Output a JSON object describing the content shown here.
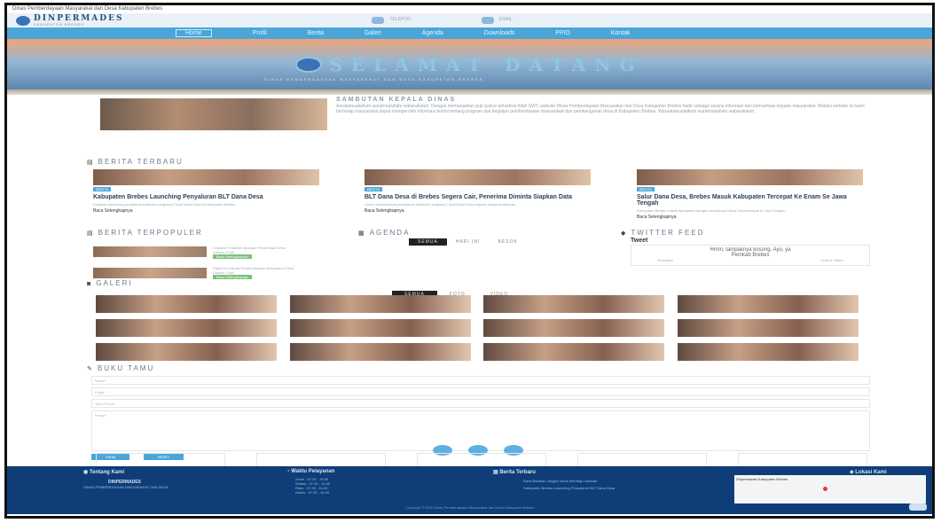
{
  "browser": {
    "title": "Dinas Pemberdayaan Masyarakat dan Desa Kabupaten Brebes"
  },
  "brand": {
    "name": "DINPERMADES",
    "tagline": "KABUPATEN BREBES"
  },
  "header": {
    "phone_label": "TELEPON",
    "email_label": "EMAIL"
  },
  "nav": {
    "items": [
      "Home",
      "Profil",
      "Berita",
      "Galeri",
      "Agenda",
      "Downloads",
      "PPID",
      "Kontak"
    ],
    "active": "Home"
  },
  "hero": {
    "title": "SELAMAT DATANG",
    "subtitle": "DINAS PEMBERDAYAAN MASYARAKAT DAN DESA KABUPATEN BREBES"
  },
  "welcome": {
    "title": "SAMBUTAN KEPALA DINAS",
    "body": "Assalamualaikum warahmatullahi wabarakatuh. Dengan memanjatkan puji syukur kehadirat Allah SWT, website Dinas Pemberdayaan Masyarakat dan Desa Kabupaten Brebes hadir sebagai sarana informasi dan komunikasi kepada masyarakat. Melalui website ini kami berharap masyarakat dapat memperoleh informasi terkini tentang program dan kegiatan pemberdayaan masyarakat dan pembangunan desa di Kabupaten Brebes. Wassalamualaikum warahmatullahi wabarakatuh."
  },
  "sections": {
    "latest_news": "BERITA TERBARU",
    "popular": "BERITA TERPOPULER",
    "agenda": "AGENDA",
    "twitter": "TWITTER FEED",
    "gallery": "GALERI",
    "guestbook": "BUKU TAMU"
  },
  "news": [
    {
      "tag": "BERITA",
      "title": "Kabupaten Brebes Launching Penyaluran BLT Dana Desa",
      "excerpt": "Kegiatan launching penyaluran Bantuan Langsung Tunai Dana Desa di Kabupaten Brebes.",
      "more": "Baca Selengkapnya"
    },
    {
      "tag": "BERITA",
      "title": "BLT Dana Desa di Brebes Segera Cair, Penerima Diminta Siapkan Data",
      "excerpt": "Untuk mempercepat penyaluran Bantuan Langsung Tunai Dana Desa kepada warga terdampak.",
      "more": "Baca Selengkapnya"
    },
    {
      "tag": "BERITA",
      "title": "Salur Dana Desa, Brebes Masuk Kabupaten Tercepat Ke Enam Se Jawa Tengah",
      "excerpt": "Kabupaten Brebes masuk kabupaten dengan penyaluran Dana Desa tercepat di Jawa Tengah.",
      "more": "Baca Selengkapnya"
    }
  ],
  "popular": {
    "items": [
      {
        "title": "Kegiatan Pelatihan Aparatur Pemerintah Desa",
        "meta": "Dibaca: 0 kali"
      },
      {
        "title": "Rapat Koordinasi Pemberdayaan Masyarakat Desa",
        "meta": "Dibaca: 0 kali"
      }
    ],
    "button": "Baca Selengkapnya"
  },
  "agenda": {
    "tabs": [
      "SEMUA",
      "HARI INI",
      "BESOK"
    ],
    "active": "SEMUA"
  },
  "twitter": {
    "heading": "Tweet",
    "content": "Hmm, tampaknya kosong. Ayo, ya",
    "author": "Pemkab Brebes",
    "link_left": "Sematkan",
    "link_right": "Lihat di Twitter"
  },
  "gallery": {
    "tabs": [
      "SEMUA",
      "FOTO",
      "VIDEO"
    ],
    "active": "SEMUA"
  },
  "guestbook": {
    "fields": [
      "Nama*",
      "Email*",
      "Judul Pesan*"
    ],
    "message": "Pesan*",
    "submit": "KIRIM",
    "reset": "RESET"
  },
  "social": [
    "facebook-icon",
    "twitter-icon",
    "instagram-icon"
  ],
  "footer": {
    "about_title": "Tentang Kami",
    "about_name": "DINPERMADES",
    "about_desc": "DINAS PEMBERDAYAAN MASYARAKAT DAN DESA",
    "hours_title": "Waktu Pelayanan",
    "hours": [
      "Senin : 07.30 - 16.00",
      "Selasa : 07.30 - 16.00",
      "Rabu : 07.30 - 16.00",
      "Kamis : 07.30 - 16.00"
    ],
    "news_title": "Berita Terbaru",
    "news": [
      "Dana Bantuan Jangan untuk Beli Baju Lebaran",
      "Kabupaten Brebes Launching Penyaluran BLT Dana Desa"
    ],
    "location_title": "Lokasi Kami",
    "map_label": "Dinpermades Kabupaten Brebes",
    "copyright": "Copyright © 2020 Dinas Pemberdayaan Masyarakat dan Desa Kabupaten Brebes"
  },
  "colors": {
    "nav": "#4aa6d9",
    "footer": "#0e3d78",
    "accent": "#3a73b5"
  }
}
